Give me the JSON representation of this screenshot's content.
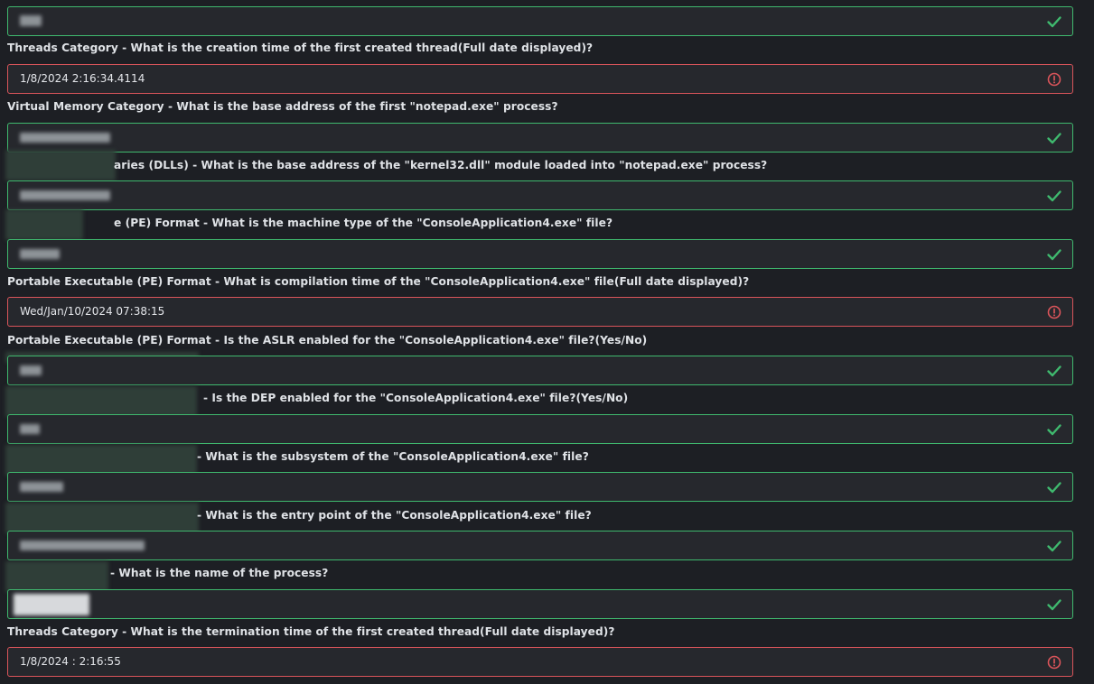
{
  "items": [
    {
      "question": "",
      "answer": "",
      "status": "correct",
      "status_icon": "check-icon"
    },
    {
      "question": "Threads Category - What is the creation time of the first created thread(Full date displayed)?",
      "answer": "1/8/2024 2:16:34.4114",
      "status": "wrong",
      "status_icon": "alert-circle-icon"
    },
    {
      "question": "Virtual Memory Category - What is the base address of the first \"notepad.exe\" process?",
      "answer": "",
      "status": "correct",
      "status_icon": "check-icon"
    },
    {
      "question": "aries (DLLs) - What is the base address of the \"kernel32.dll\" module loaded into \"notepad.exe\" process?",
      "answer": "",
      "status": "correct",
      "status_icon": "check-icon"
    },
    {
      "question": "e (PE) Format - What is the machine type of the \"ConsoleApplication4.exe\" file?",
      "answer": "",
      "status": "correct",
      "status_icon": "check-icon"
    },
    {
      "question": "Portable Executable (PE) Format - What is compilation time of the \"ConsoleApplication4.exe\" file(Full date displayed)?",
      "answer": "Wed/Jan/10/2024 07:38:15",
      "status": "wrong",
      "status_icon": "alert-circle-icon"
    },
    {
      "question": "Portable Executable (PE) Format - Is the ASLR enabled for the \"ConsoleApplication4.exe\" file?(Yes/No)",
      "answer": "",
      "status": "correct",
      "status_icon": "check-icon"
    },
    {
      "question": "- Is the DEP enabled for the \"ConsoleApplication4.exe\" file?(Yes/No)",
      "answer": "",
      "status": "correct",
      "status_icon": "check-icon"
    },
    {
      "question": "- What is the subsystem of the \"ConsoleApplication4.exe\" file?",
      "answer": "",
      "status": "correct",
      "status_icon": "check-icon"
    },
    {
      "question": "- What is the entry point of the \"ConsoleApplication4.exe\" file?",
      "answer": "",
      "status": "correct",
      "status_icon": "check-icon"
    },
    {
      "question": "- What is the name of the process?",
      "answer": "",
      "status": "correct",
      "status_icon": "check-icon"
    },
    {
      "question": "Threads Category - What is the termination time of the first created thread(Full date displayed)?",
      "answer": "1/8/2024 : 2:16:55",
      "status": "wrong",
      "status_icon": "alert-circle-icon"
    }
  ],
  "colors": {
    "background": "#1d1f24",
    "field_background": "#26282d",
    "correct": "#3fb96e",
    "wrong": "#d9545a",
    "text": "#dfe2e6"
  }
}
